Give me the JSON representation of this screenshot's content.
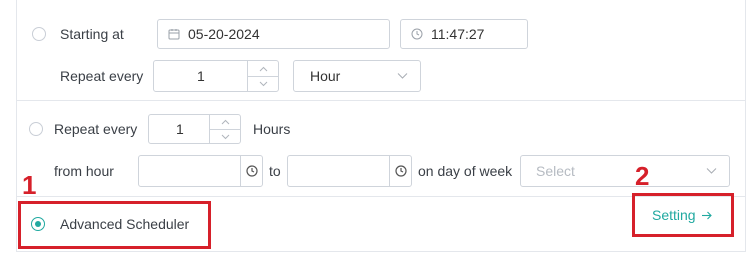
{
  "schedule": {
    "option1": {
      "starting_label": "Starting at",
      "date_value": "05-20-2024",
      "time_value": "11:47:27",
      "repeat_label": "Repeat every",
      "repeat_value": "1",
      "unit_value": "Hour"
    },
    "option2": {
      "repeat_label": "Repeat every",
      "repeat_value": "1",
      "hours_label": "Hours",
      "from_hour_label": "from hour",
      "from_hour_value": "",
      "to_label": "to",
      "to_value": "",
      "day_label": "on day of week",
      "day_placeholder": "Select"
    },
    "option3": {
      "label": "Advanced Scheduler",
      "setting_label": "Setting",
      "selected": true
    }
  },
  "annotations": {
    "marker1": "1",
    "marker2": "2"
  },
  "colors": {
    "accent": "#20a9a0",
    "annotation": "#d6202a",
    "border": "#cfd4db"
  }
}
